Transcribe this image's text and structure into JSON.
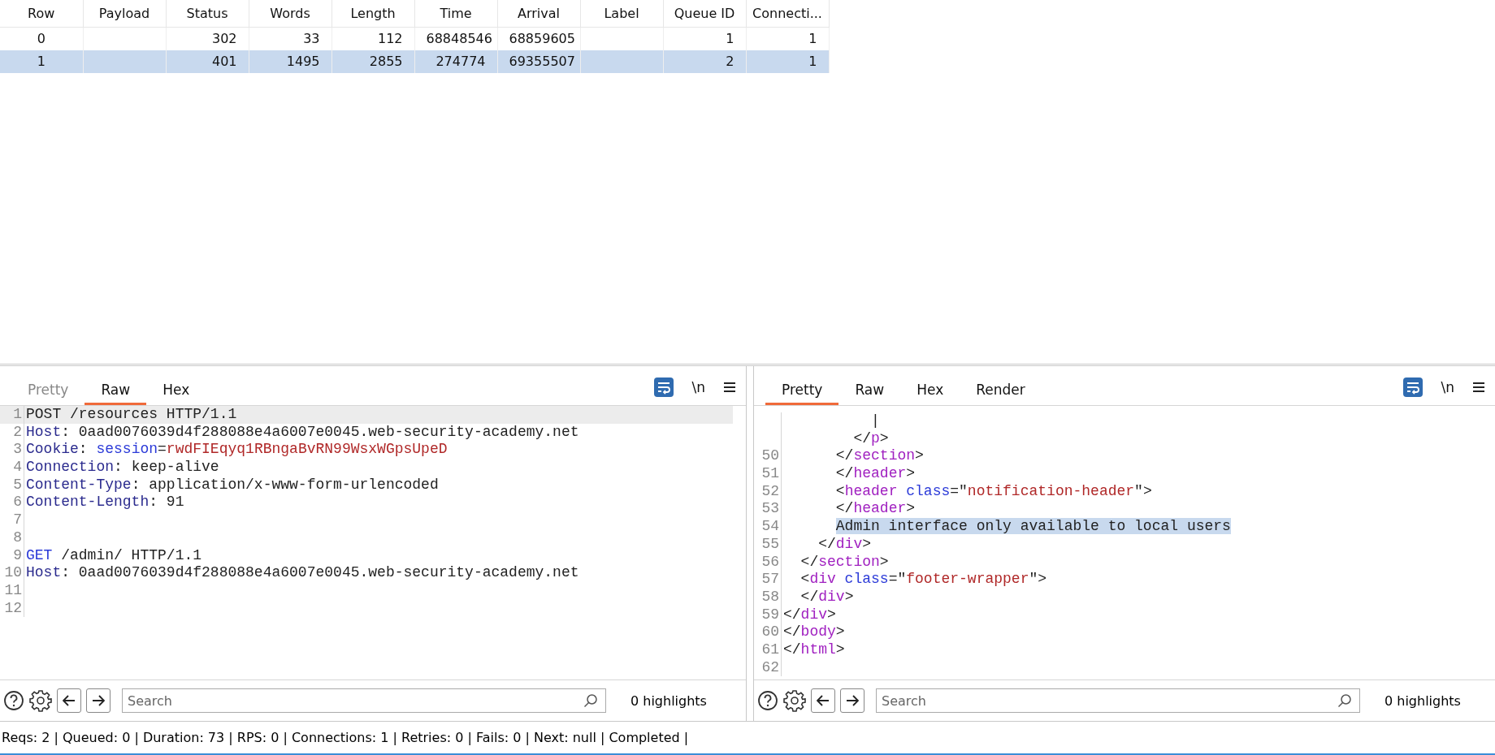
{
  "table": {
    "columns": [
      "Row",
      "Payload",
      "Status",
      "Words",
      "Length",
      "Time",
      "Arrival",
      "Label",
      "Queue ID",
      "Connecti..."
    ],
    "rows": [
      {
        "selected": false,
        "cells": [
          "0",
          "",
          "302",
          "33",
          "112",
          "68848546",
          "68859605",
          "",
          "1",
          "1"
        ]
      },
      {
        "selected": true,
        "cells": [
          "1",
          "",
          "401",
          "1495",
          "2855",
          "274774",
          "69355507",
          "",
          "2",
          "1"
        ]
      }
    ]
  },
  "panes": [
    {
      "tabs": [
        {
          "label": "Pretty",
          "selected": false,
          "disabled": true
        },
        {
          "label": "Raw",
          "selected": true,
          "disabled": false
        },
        {
          "label": "Hex",
          "selected": false,
          "disabled": false
        }
      ],
      "newline_toggle": "\\n",
      "lines": [
        {
          "number": "1",
          "current": true,
          "selected": false,
          "segments": [
            {
              "text": "POST /resources HTTP/1.1",
              "kind": "plain"
            }
          ]
        },
        {
          "number": "2",
          "current": false,
          "selected": false,
          "segments": [
            {
              "text": "Host",
              "kind": "key"
            },
            {
              "text": ": 0aad0076039d4f288088e4a6007e0045.web-security-academy.net",
              "kind": "plain"
            }
          ]
        },
        {
          "number": "3",
          "current": false,
          "selected": false,
          "segments": [
            {
              "text": "Cookie",
              "kind": "key"
            },
            {
              "text": ": ",
              "kind": "plain"
            },
            {
              "text": "session",
              "kind": "attr"
            },
            {
              "text": "=",
              "kind": "plain"
            },
            {
              "text": "rwdFIEqyq1RBngaBvRN99WsxWGpsUpeD",
              "kind": "string"
            }
          ]
        },
        {
          "number": "4",
          "current": false,
          "selected": false,
          "segments": [
            {
              "text": "Connection",
              "kind": "key"
            },
            {
              "text": ": keep-alive",
              "kind": "plain"
            }
          ]
        },
        {
          "number": "5",
          "current": false,
          "selected": false,
          "segments": [
            {
              "text": "Content-Type",
              "kind": "key"
            },
            {
              "text": ": application/x-www-form-urlencoded",
              "kind": "plain"
            }
          ]
        },
        {
          "number": "6",
          "current": false,
          "selected": false,
          "segments": [
            {
              "text": "Content-Length",
              "kind": "key"
            },
            {
              "text": ": 91",
              "kind": "plain"
            }
          ]
        },
        {
          "number": "7",
          "current": false,
          "selected": false
        },
        {
          "number": "8",
          "current": false,
          "selected": false
        },
        {
          "number": "9",
          "current": false,
          "selected": false,
          "segments": [
            {
              "text": "GET",
              "kind": "attr"
            },
            {
              "text": " /admin/ HTTP/1.1",
              "kind": "plain"
            }
          ]
        },
        {
          "number": "10",
          "current": false,
          "selected": false,
          "segments": [
            {
              "text": "Host",
              "kind": "key"
            },
            {
              "text": ": 0aad0076039d4f288088e4a6007e0045.web-security-academy.net",
              "kind": "plain"
            }
          ]
        },
        {
          "number": "11",
          "current": false,
          "selected": false
        },
        {
          "number": "12",
          "current": false,
          "selected": false
        }
      ],
      "search": {
        "placeholder": "Search"
      },
      "highlights": "0 highlights"
    },
    {
      "tabs": [
        {
          "label": "Pretty",
          "selected": true,
          "disabled": false
        },
        {
          "label": "Raw",
          "selected": false,
          "disabled": false
        },
        {
          "label": "Hex",
          "selected": false,
          "disabled": false
        },
        {
          "label": "Render",
          "selected": false,
          "disabled": false
        }
      ],
      "newline_toggle": "\\n",
      "lines": [
        {
          "current": false,
          "selected": false,
          "segments": [
            {
              "text": "          |",
              "kind": "plain"
            }
          ]
        },
        {
          "current": false,
          "selected": false,
          "segments": [
            {
              "text": "        </",
              "kind": "plain"
            },
            {
              "text": "p",
              "kind": "tag"
            },
            {
              "text": ">",
              "kind": "plain"
            }
          ]
        },
        {
          "number": "50",
          "current": false,
          "selected": false,
          "segments": [
            {
              "text": "      </",
              "kind": "plain"
            },
            {
              "text": "section",
              "kind": "tag"
            },
            {
              "text": ">",
              "kind": "plain"
            }
          ]
        },
        {
          "number": "51",
          "current": false,
          "selected": false,
          "segments": [
            {
              "text": "      </",
              "kind": "plain"
            },
            {
              "text": "header",
              "kind": "tag"
            },
            {
              "text": ">",
              "kind": "plain"
            }
          ]
        },
        {
          "number": "52",
          "current": false,
          "selected": false,
          "segments": [
            {
              "text": "      <",
              "kind": "plain"
            },
            {
              "text": "header",
              "kind": "tag"
            },
            {
              "text": " class",
              "kind": "attr"
            },
            {
              "text": "=\"",
              "kind": "plain"
            },
            {
              "text": "notification-header",
              "kind": "string"
            },
            {
              "text": "\">",
              "kind": "plain"
            }
          ]
        },
        {
          "number": "53",
          "current": false,
          "selected": false,
          "segments": [
            {
              "text": "      </",
              "kind": "plain"
            },
            {
              "text": "header",
              "kind": "tag"
            },
            {
              "text": ">",
              "kind": "plain"
            }
          ]
        },
        {
          "number": "54",
          "current": false,
          "selected": true,
          "segments": [
            {
              "text": "      Admin interface only available to local users",
              "kind": "plain"
            }
          ]
        },
        {
          "number": "55",
          "current": false,
          "selected": false,
          "segments": [
            {
              "text": "    </",
              "kind": "plain"
            },
            {
              "text": "div",
              "kind": "tag"
            },
            {
              "text": ">",
              "kind": "plain"
            }
          ]
        },
        {
          "number": "56",
          "current": false,
          "selected": false,
          "segments": [
            {
              "text": "  </",
              "kind": "plain"
            },
            {
              "text": "section",
              "kind": "tag"
            },
            {
              "text": ">",
              "kind": "plain"
            }
          ]
        },
        {
          "number": "57",
          "current": false,
          "selected": false,
          "segments": [
            {
              "text": "  <",
              "kind": "plain"
            },
            {
              "text": "div",
              "kind": "tag"
            },
            {
              "text": " class",
              "kind": "attr"
            },
            {
              "text": "=\"",
              "kind": "plain"
            },
            {
              "text": "footer-wrapper",
              "kind": "string"
            },
            {
              "text": "\">",
              "kind": "plain"
            }
          ]
        },
        {
          "number": "58",
          "current": false,
          "selected": false,
          "segments": [
            {
              "text": "  </",
              "kind": "plain"
            },
            {
              "text": "div",
              "kind": "tag"
            },
            {
              "text": ">",
              "kind": "plain"
            }
          ]
        },
        {
          "number": "59",
          "current": false,
          "selected": false,
          "segments": [
            {
              "text": "</",
              "kind": "plain"
            },
            {
              "text": "div",
              "kind": "tag"
            },
            {
              "text": ">",
              "kind": "plain"
            }
          ]
        },
        {
          "number": "60",
          "current": false,
          "selected": false,
          "segments": [
            {
              "text": "</",
              "kind": "plain"
            },
            {
              "text": "body",
              "kind": "tag"
            },
            {
              "text": ">",
              "kind": "plain"
            }
          ]
        },
        {
          "number": "61",
          "current": false,
          "selected": false,
          "segments": [
            {
              "text": "</",
              "kind": "plain"
            },
            {
              "text": "html",
              "kind": "tag"
            },
            {
              "text": ">",
              "kind": "plain"
            }
          ]
        },
        {
          "number": "62",
          "current": false,
          "selected": false
        }
      ],
      "search": {
        "placeholder": "Search"
      },
      "highlights": "0 highlights"
    }
  ],
  "status_bar": "Reqs: 2 | Queued: 0 | Duration: 73 | RPS: 0 | Connections: 1 | Retries: 0 | Fails: 0 | Next: null | Completed |"
}
